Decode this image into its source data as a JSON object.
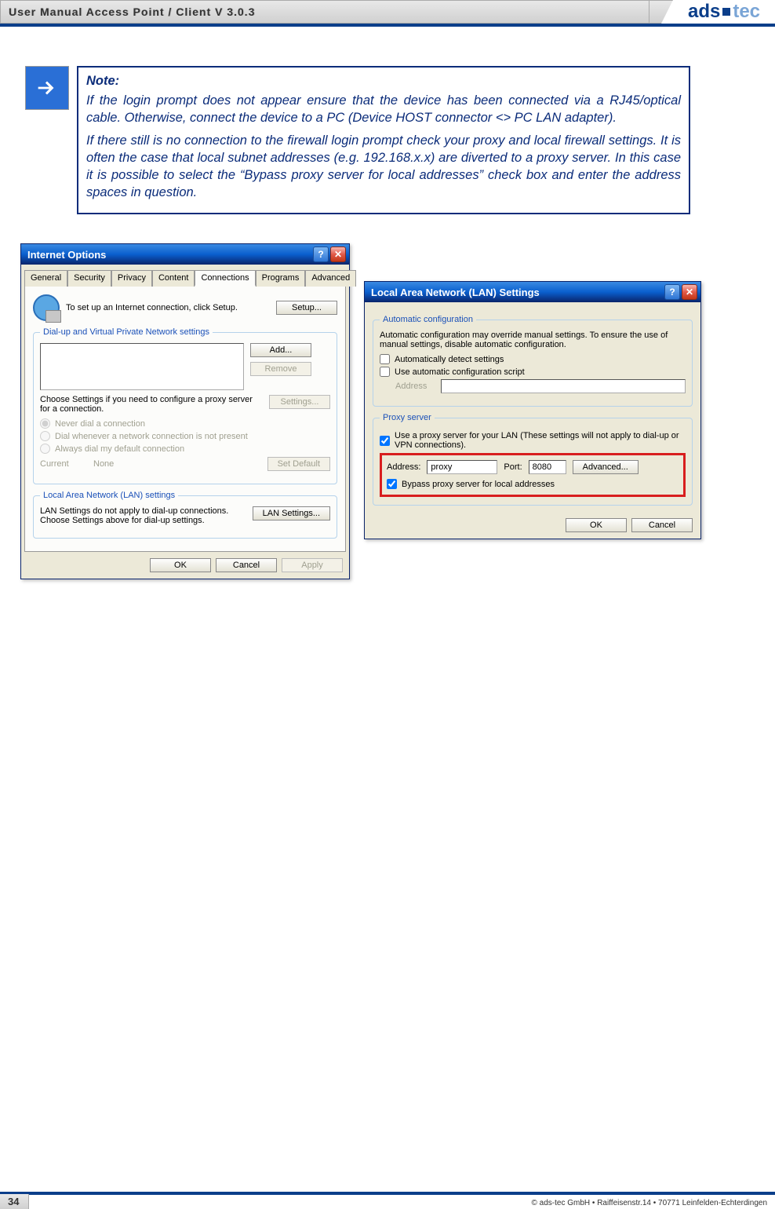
{
  "header": {
    "title": "User Manual Access Point / Client V 3.0.3",
    "logo_left": "ads",
    "logo_right": "tec"
  },
  "note": {
    "heading": "Note:",
    "para1": "If the login prompt does not appear ensure that the device has been connected via a RJ45/optical cable. Otherwise, connect the device to a PC (Device HOST connector <> PC LAN adapter).",
    "para2": "If there still is no connection to the firewall login prompt check your proxy and local firewall settings. It is often the case that local subnet addresses (e.g. 192.168.x.x) are diverted to a proxy server. In this case it is possible to select the “Bypass proxy server for local addresses” check box and enter the address spaces in question."
  },
  "win1": {
    "title": "Internet Options",
    "tabs": [
      "General",
      "Security",
      "Privacy",
      "Content",
      "Connections",
      "Programs",
      "Advanced"
    ],
    "active_tab": 4,
    "setup_text": "To set up an Internet connection, click Setup.",
    "btn_setup": "Setup...",
    "grp_dial": "Dial-up and Virtual Private Network settings",
    "btn_add": "Add...",
    "btn_remove": "Remove",
    "choose_text": "Choose Settings if you need to configure a proxy server for a connection.",
    "btn_settings": "Settings...",
    "r_never": "Never dial a connection",
    "r_when": "Dial whenever a network connection is not present",
    "r_always": "Always dial my default connection",
    "current_label": "Current",
    "current_value": "None",
    "btn_setdefault": "Set Default",
    "grp_lan": "Local Area Network (LAN) settings",
    "lan_text": "LAN Settings do not apply to dial-up connections. Choose Settings above for dial-up settings.",
    "btn_lan": "LAN Settings...",
    "btn_ok": "OK",
    "btn_cancel": "Cancel",
    "btn_apply": "Apply"
  },
  "win2": {
    "title": "Local Area Network (LAN) Settings",
    "grp_auto": "Automatic configuration",
    "auto_text": "Automatic configuration may override manual settings. To ensure the use of manual settings, disable automatic configuration.",
    "chk_autodetect": "Automatically detect settings",
    "chk_autoscript": "Use automatic configuration script",
    "addr_label": "Address",
    "grp_proxy": "Proxy server",
    "chk_useproxy": "Use a proxy server for your LAN (These settings will not apply to dial-up or VPN connections).",
    "addr2_label": "Address:",
    "addr2_value": "proxy",
    "port_label": "Port:",
    "port_value": "8080",
    "btn_adv": "Advanced...",
    "chk_bypass": "Bypass proxy server for local addresses",
    "btn_ok": "OK",
    "btn_cancel": "Cancel"
  },
  "footer": {
    "page": "34",
    "copy": "© ads-tec GmbH • Raiffeisenstr.14 • 70771 Leinfelden-Echterdingen"
  }
}
